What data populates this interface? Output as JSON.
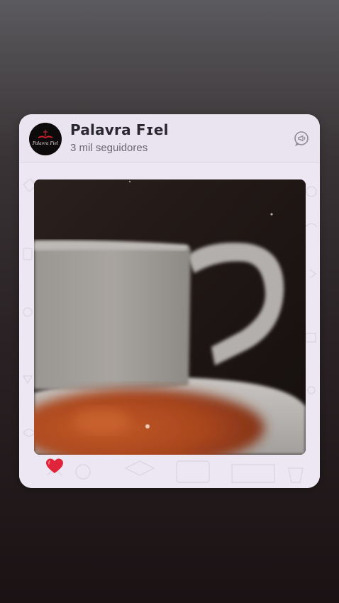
{
  "channel": {
    "name": "Palavra Fɪel",
    "followers": "3 mil seguidores",
    "avatar_text": "Palavra Fiel"
  },
  "post": {
    "media_alt": "coffee-cup-photo",
    "reaction_emoji": "heart-icon"
  },
  "icons": {
    "channel": "channel-announce-icon",
    "reaction": "heart-icon"
  },
  "colors": {
    "card_bg": "#ebe6f1",
    "heart": "#e0243a",
    "name": "#2b2730",
    "followers": "#6b6770"
  }
}
